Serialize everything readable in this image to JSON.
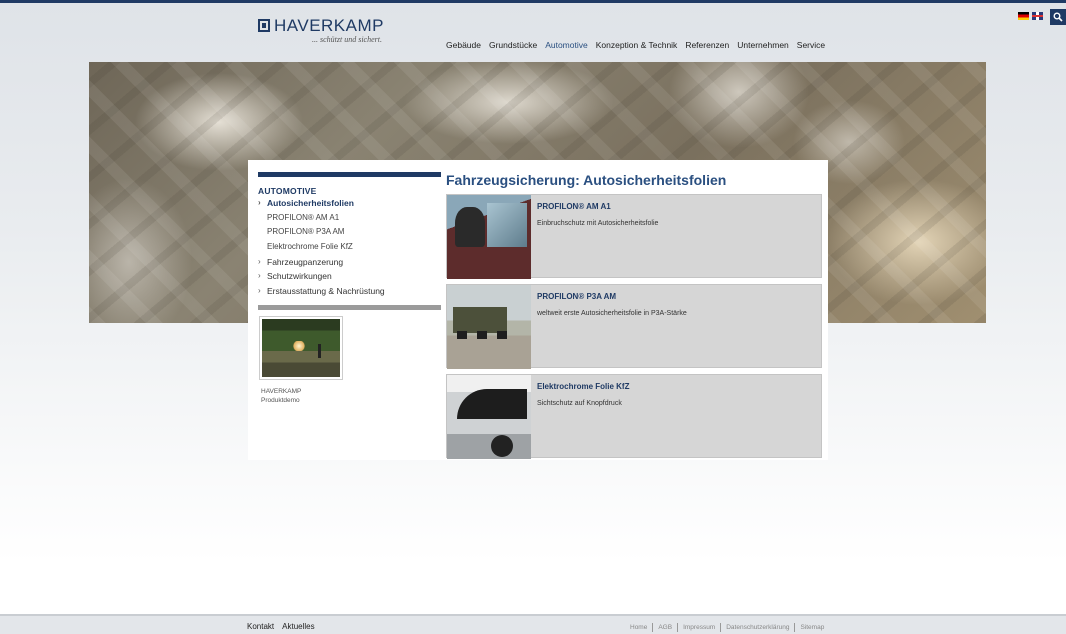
{
  "brand": {
    "name": "HAVERKAMP",
    "tagline": "... schützt und sichert."
  },
  "main_nav": [
    {
      "label": "Gebäude"
    },
    {
      "label": "Grundstücke"
    },
    {
      "label": "Automotive",
      "active": true
    },
    {
      "label": "Konzeption & Technik"
    },
    {
      "label": "Referenzen"
    },
    {
      "label": "Unternehmen"
    },
    {
      "label": "Service"
    }
  ],
  "languages": [
    "de-flag-icon",
    "en-flag-icon"
  ],
  "sidebar": {
    "title": "AUTOMOTIVE",
    "items": [
      {
        "label": "Autosicherheitsfolien",
        "level": 1,
        "active": true
      },
      {
        "label": "PROFILON® AM A1",
        "level": 2
      },
      {
        "label": "PROFILON® P3A AM",
        "level": 2
      },
      {
        "label": "Elektrochrome Folie KfZ",
        "level": 2
      },
      {
        "label": "Fahrzeugpanzerung",
        "level": 1
      },
      {
        "label": "Schutzwirkungen",
        "level": 1
      },
      {
        "label": "Erstausstattung & Nachrüstung",
        "level": 1
      }
    ],
    "video_caption_line1": "HAVERKAMP",
    "video_caption_line2": "Produktdemo"
  },
  "page_title": "Fahrzeugsicherung: Autosicherheitsfolien",
  "products": [
    {
      "name": "PROFILON® AM A1",
      "description": "Einbruchschutz mit Autosicherheitsfolie"
    },
    {
      "name": "PROFILON® P3A AM",
      "description": "weltweit erste Autosicherheitsfolie in P3A-Stärke"
    },
    {
      "name": "Elektrochrome Folie KfZ",
      "description": "Sichtschutz auf Knopfdruck"
    }
  ],
  "footer": {
    "left": [
      "Kontakt",
      "Aktuelles"
    ],
    "right": [
      "Home",
      "AGB",
      "Impressum",
      "Datenschutzerklärung",
      "Sitemap"
    ]
  },
  "colors": {
    "brand_navy": "#1f3a64",
    "accent_blue": "#2a4f80",
    "product_bg": "#d6d6d6"
  }
}
